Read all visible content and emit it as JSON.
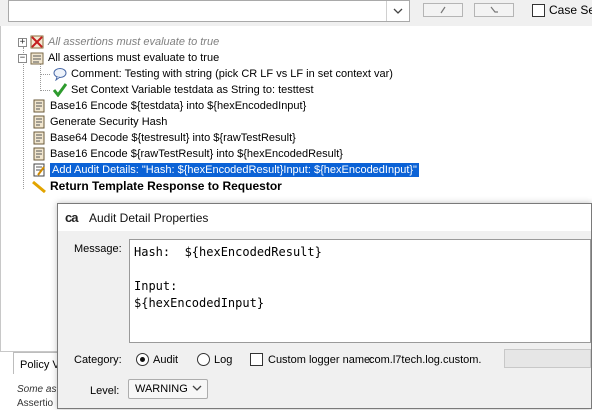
{
  "toolbar": {
    "search_value": "",
    "case_label": "Case Sen"
  },
  "tree": {
    "items": [
      {
        "label": "All assertions must evaluate to true"
      },
      {
        "label": "All assertions must evaluate to true"
      },
      {
        "label": "Comment: Testing with string (pick CR LF vs LF in set context var)"
      },
      {
        "label": "Set Context Variable testdata as String to: testtest"
      },
      {
        "label": "Base16 Encode ${testdata} into ${hexEncodedInput}"
      },
      {
        "label": "Generate Security Hash"
      },
      {
        "label": "Base64 Decode ${testresult} into ${rawTestResult}"
      },
      {
        "label": "Base16 Encode ${rawTestResult} into ${hexEncodedResult}"
      },
      {
        "label": "Add Audit Details: \"Hash:  ${hexEncodedResult}Input: ${hexEncodedInput}\""
      },
      {
        "label": "Return Template Response to Requestor"
      }
    ]
  },
  "policy_panel": {
    "tab_label": "Policy Va",
    "line1": "Some as",
    "line2": "Assertio"
  },
  "dialog": {
    "logo": "ca",
    "title": "Audit Detail Properties",
    "message_label": "Message:",
    "message_lines": [
      "Hash:  ${hexEncodedResult}",
      "",
      "Input:",
      "${hexEncodedInput}"
    ],
    "category_label": "Category:",
    "audit_label": "Audit",
    "log_label": "Log",
    "custom_logger_label": "Custom logger name:",
    "custom_logger_value": "com.l7tech.log.custom.",
    "level_label": "Level:",
    "level_value": "WARNING"
  },
  "colors": {
    "selection": "#0b62d6",
    "disabled_text": "#808080",
    "check_green": "#2e9b2e",
    "dialog_bg": "#f0f0f0"
  },
  "icons": [
    "expand-icon",
    "collapse-icon",
    "all-assertions-disabled-icon",
    "all-assertions-icon",
    "comment-icon",
    "checkmark-icon",
    "assertion-scroll-icon",
    "audit-details-icon",
    "return-template-icon",
    "chevron-down-icon"
  ]
}
